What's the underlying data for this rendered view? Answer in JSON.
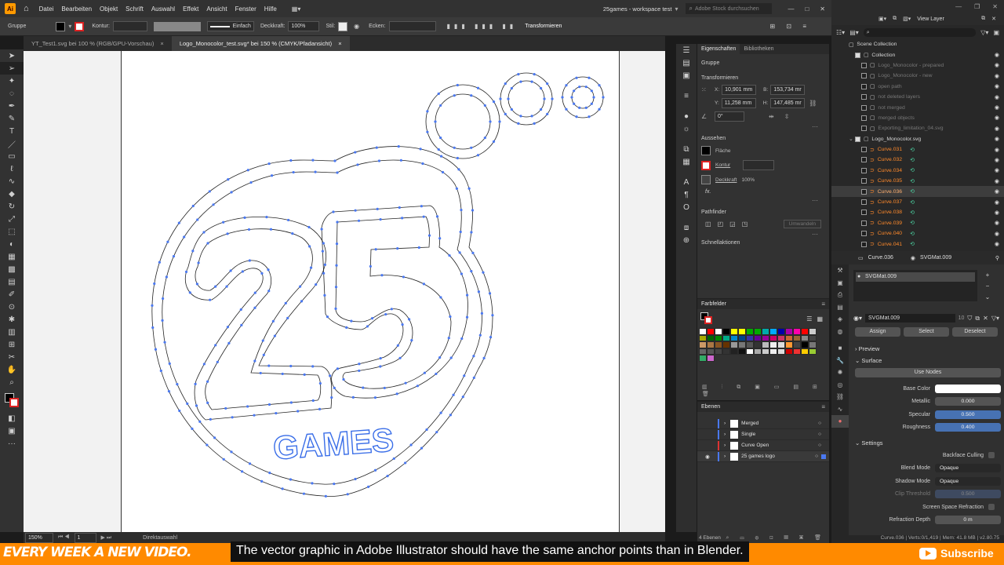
{
  "illustrator": {
    "menu": [
      "Datei",
      "Bearbeiten",
      "Objekt",
      "Schrift",
      "Auswahl",
      "Effekt",
      "Ansicht",
      "Fenster",
      "Hilfe"
    ],
    "workspace": "25games - workspace test",
    "stock_search_placeholder": "Adobe Stock durchsuchen",
    "control": {
      "group_label": "Gruppe",
      "kontur_label": "Kontur:",
      "stroke_style": "Einfach",
      "opacity_label": "Deckkraft:",
      "opacity_value": "100%",
      "style_label": "Stil:",
      "corners_label": "Ecken:",
      "transform_label": "Transformieren"
    },
    "tabs": [
      {
        "label": "YT_Test1.svg bei 100 % (RGB/GPU-Vorschau)",
        "active": false
      },
      {
        "label": "Logo_Monocolor_test.svg* bei 150 % (CMYK/Pfadansicht)",
        "active": true
      }
    ],
    "status": {
      "zoom": "150%",
      "artboard": "1",
      "tool": "Direktauswahl"
    },
    "logo_text": "GAMES",
    "props": {
      "tab_properties": "Eigenschaften",
      "tab_libraries": "Bibliotheken",
      "type": "Gruppe",
      "transform_title": "Transformieren",
      "x_label": "X:",
      "x": "10,901 mm",
      "y_label": "Y:",
      "y": "11,258 mm",
      "w_label": "B:",
      "w": "153,734 mr",
      "h_label": "H:",
      "h": "147,485 mr",
      "angle": "0°",
      "appearance_title": "Aussehen",
      "fill_label": "Fläche",
      "stroke_label": "Kontur",
      "opacity_label": "Deckkraft",
      "opacity_value": "100%",
      "fx": "fx.",
      "pathfinder_title": "Pathfinder",
      "expand_btn": "Umwandeln",
      "quick_title": "Schnellaktionen"
    },
    "swatches_title": "Farbfelder",
    "layers_title": "Ebenen",
    "layers": [
      "Merged",
      "Single",
      "Curve Open",
      "25 games logo"
    ],
    "layer_count": "4 Ebenen"
  },
  "blender": {
    "view_layer": "View Layer",
    "scene_collection": "Scene Collection",
    "outliner": [
      {
        "label": "Collection",
        "style": "normal",
        "checked": true,
        "indent": 1
      },
      {
        "label": "Logo_Monocolor - prepared",
        "style": "dim",
        "indent": 2
      },
      {
        "label": "Logo_Monocolor - new",
        "style": "dim",
        "indent": 2
      },
      {
        "label": "open path",
        "style": "dim",
        "indent": 2
      },
      {
        "label": "not deleted layers",
        "style": "dim",
        "indent": 2
      },
      {
        "label": "not merged",
        "style": "dim",
        "indent": 2
      },
      {
        "label": "merged objects",
        "style": "dim",
        "indent": 2
      },
      {
        "label": "Exporting_limitation_04.svg",
        "style": "dim",
        "indent": 2
      },
      {
        "label": "Logo_Monocolor.svg",
        "style": "normal",
        "checked": true,
        "indent": 1
      },
      {
        "label": "Curve.031",
        "style": "curve",
        "indent": 2
      },
      {
        "label": "Curve.032",
        "style": "curve",
        "indent": 2
      },
      {
        "label": "Curve.034",
        "style": "curve",
        "indent": 2
      },
      {
        "label": "Curve.035",
        "style": "curve",
        "indent": 2
      },
      {
        "label": "Curve.036",
        "style": "curve",
        "selected": true,
        "indent": 2
      },
      {
        "label": "Curve.037",
        "style": "curve",
        "indent": 2
      },
      {
        "label": "Curve.038",
        "style": "curve",
        "indent": 2
      },
      {
        "label": "Curve.039",
        "style": "curve",
        "indent": 2
      },
      {
        "label": "Curve.040",
        "style": "curve",
        "indent": 2
      },
      {
        "label": "Curve.041",
        "style": "curve",
        "indent": 2
      }
    ],
    "props_object": "Curve.036",
    "props_material": "SVGMat.009",
    "material_slot": "SVGMat.009",
    "material_users": "10",
    "assign": "Assign",
    "select": "Select",
    "deselect": "Deselect",
    "preview": "Preview",
    "surface": "Surface",
    "use_nodes": "Use Nodes",
    "base_color_label": "Base Color",
    "metallic_label": "Metallic",
    "metallic": "0.000",
    "specular_label": "Specular",
    "specular": "0.500",
    "roughness_label": "Roughness",
    "roughness": "0.400",
    "settings": "Settings",
    "backface_label": "Backface Culling",
    "blend_label": "Blend Mode",
    "blend": "Opaque",
    "shadow_label": "Shadow Mode",
    "shadow": "Opaque",
    "clip_label": "Clip Threshold",
    "clip": "0.500",
    "ssr_label": "Screen Space Refraction",
    "refraction_label": "Refraction Depth",
    "refraction": "0 m",
    "status": "Curve.036 | Verts:0/1,419 | Mem: 41.8 MB | v2.80.75"
  },
  "video": {
    "brand": "EVERY WEEK A NEW VIDEO.",
    "subtitle": "The vector graphic in Adobe Illustrator should have the same anchor points than in Blender.",
    "subscribe": "Subscribe"
  },
  "colors": {
    "accent_orange": "#ff8a00",
    "path_blue": "#3a6ee8",
    "blender_curve": "#ff8a2b"
  }
}
